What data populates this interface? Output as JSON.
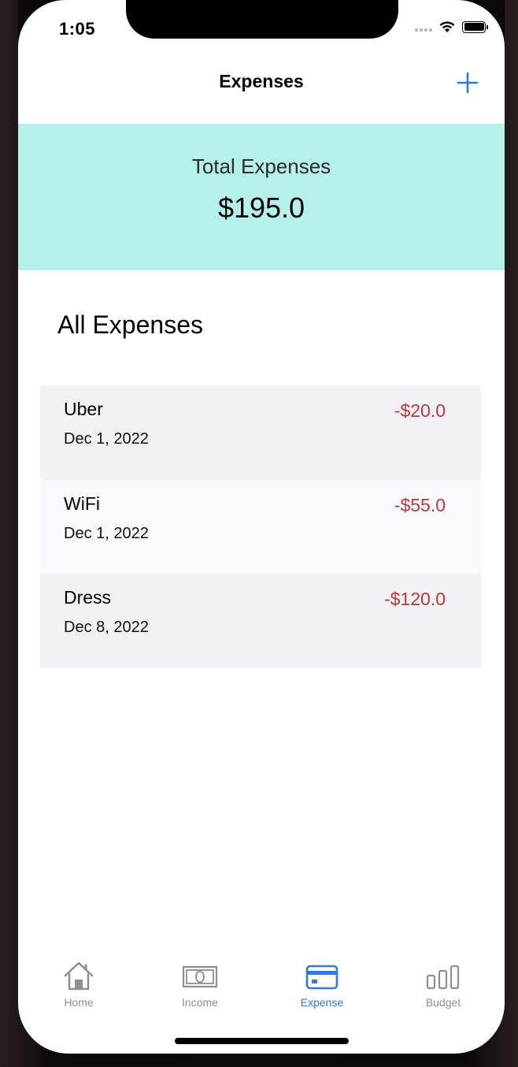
{
  "status_bar": {
    "time": "1:05"
  },
  "nav": {
    "title": "Expenses",
    "add_icon": "plus-icon"
  },
  "summary": {
    "label": "Total Expenses",
    "value": "$195.0",
    "background_color": "#b5f0ea"
  },
  "section": {
    "title": "All Expenses"
  },
  "expenses": [
    {
      "name": "Uber",
      "date": "Dec 1, 2022",
      "amount": "-$20.0"
    },
    {
      "name": "WiFi",
      "date": "Dec 1, 2022",
      "amount": "-$55.0"
    },
    {
      "name": "Dress",
      "date": "Dec 8, 2022",
      "amount": "-$120.0"
    }
  ],
  "tabs": [
    {
      "label": "Home",
      "icon": "house-icon",
      "active": false
    },
    {
      "label": "Income",
      "icon": "banknote-icon",
      "active": false
    },
    {
      "label": "Expense",
      "icon": "credit-card-icon",
      "active": true
    },
    {
      "label": "Budget",
      "icon": "bar-chart-icon",
      "active": false
    }
  ],
  "colors": {
    "accent": "#2f7bd6",
    "negative_amount": "#b83a3a",
    "inactive_tab": "#8e8e93"
  }
}
